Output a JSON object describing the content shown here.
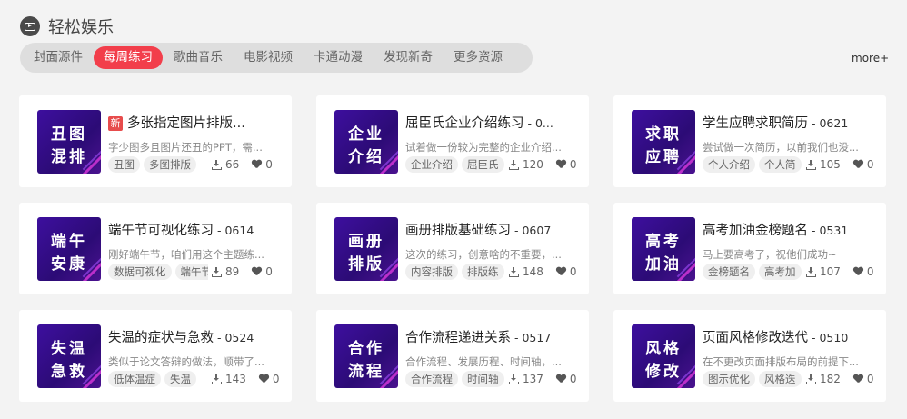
{
  "header": {
    "title": "轻松娱乐",
    "icon": "video-play-icon"
  },
  "tabs": [
    {
      "label": "封面源件",
      "active": false
    },
    {
      "label": "每周练习",
      "active": true
    },
    {
      "label": "歌曲音乐",
      "active": false
    },
    {
      "label": "电影视频",
      "active": false
    },
    {
      "label": "卡通动漫",
      "active": false
    },
    {
      "label": "发现新奇",
      "active": false
    },
    {
      "label": "更多资源",
      "active": false
    }
  ],
  "more_label": "more+",
  "accent_color": "#f23e4b",
  "cards": [
    {
      "thumb1": "丑图",
      "thumb2": "混排",
      "is_new": true,
      "new_label": "新",
      "title": "多张指定图片排版...",
      "date": "",
      "desc": "字少图多且图片还丑的PPT，需...",
      "tags": [
        "丑图",
        "多图排版"
      ],
      "downloads": "66",
      "likes": "0"
    },
    {
      "thumb1": "企业",
      "thumb2": "介绍",
      "is_new": false,
      "new_label": "",
      "title": "屈臣氏企业介绍练习",
      "date": " - 0...",
      "desc": "试着做一份较为完整的企业介绍...",
      "tags": [
        "企业介绍",
        "屈臣氏"
      ],
      "downloads": "120",
      "likes": "0"
    },
    {
      "thumb1": "求职",
      "thumb2": "应聘",
      "is_new": false,
      "new_label": "",
      "title": "学生应聘求职简历",
      "date": " - 0621",
      "desc": "尝试做一次简历，以前我们也没...",
      "tags": [
        "个人介绍",
        "个人简"
      ],
      "downloads": "105",
      "likes": "0"
    },
    {
      "thumb1": "端午",
      "thumb2": "安康",
      "is_new": false,
      "new_label": "",
      "title": "端午节可视化练习",
      "date": " - 0614",
      "desc": "刚好端午节，咱们用这个主题练...",
      "tags": [
        "数据可视化",
        "端午节"
      ],
      "downloads": "89",
      "likes": "0"
    },
    {
      "thumb1": "画册",
      "thumb2": "排版",
      "is_new": false,
      "new_label": "",
      "title": "画册排版基础练习",
      "date": " - 0607",
      "desc": "这次的练习，创意啥的不重要，...",
      "tags": [
        "内容排版",
        "排版练"
      ],
      "downloads": "148",
      "likes": "0"
    },
    {
      "thumb1": "高考",
      "thumb2": "加油",
      "is_new": false,
      "new_label": "",
      "title": "高考加油金榜题名",
      "date": " - 0531",
      "desc": "马上要高考了，祝他们成功~",
      "tags": [
        "金榜题名",
        "高考加"
      ],
      "downloads": "107",
      "likes": "0"
    },
    {
      "thumb1": "失温",
      "thumb2": "急救",
      "is_new": false,
      "new_label": "",
      "title": "失温的症状与急救",
      "date": " - 0524",
      "desc": "类似于论文答辩的做法，顺带了...",
      "tags": [
        "低体温症",
        "失温"
      ],
      "downloads": "143",
      "likes": "0"
    },
    {
      "thumb1": "合作",
      "thumb2": "流程",
      "is_new": false,
      "new_label": "",
      "title": "合作流程递进关系",
      "date": " - 0517",
      "desc": "合作流程、发展历程、时间轴，...",
      "tags": [
        "合作流程",
        "时间轴"
      ],
      "downloads": "137",
      "likes": "0"
    },
    {
      "thumb1": "风格",
      "thumb2": "修改",
      "is_new": false,
      "new_label": "",
      "title": "页面风格修改迭代",
      "date": " - 0510",
      "desc": "在不更改页面排版布局的前提下...",
      "tags": [
        "图示优化",
        "风格迭"
      ],
      "downloads": "182",
      "likes": "0"
    }
  ]
}
